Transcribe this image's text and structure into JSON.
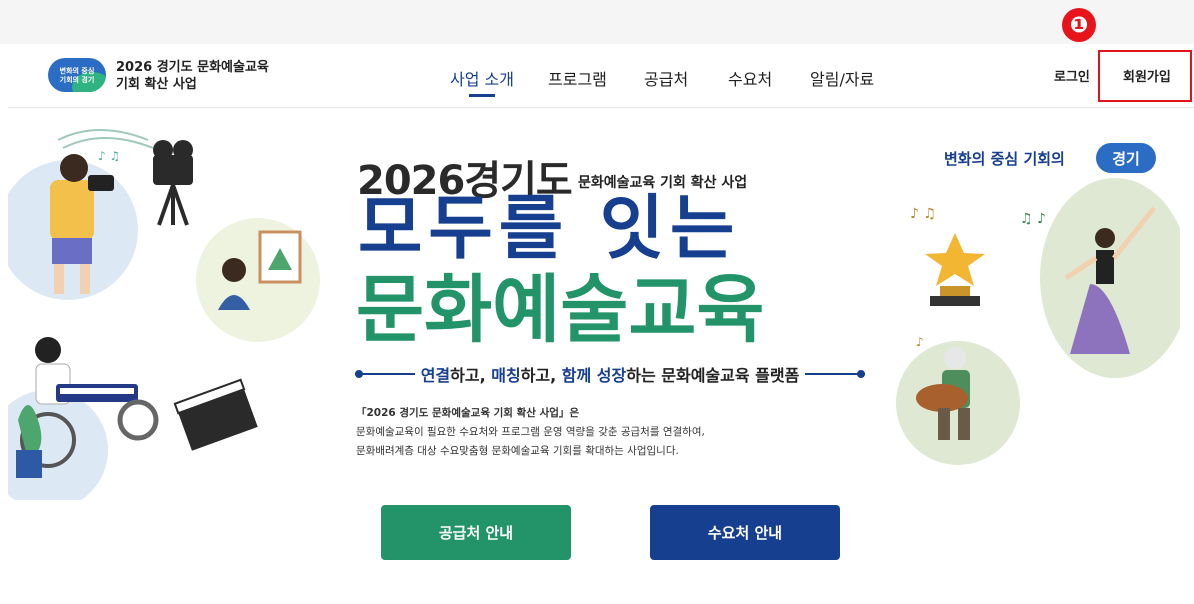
{
  "step_marker": "❶",
  "header": {
    "logo_line1": "변화의 중심",
    "logo_line2": "기회의 경기",
    "site_title_line1": "2026 경기도 문화예술교육",
    "site_title_line2": "기회 확산 사업",
    "nav": [
      {
        "label": "사업 소개",
        "active": true
      },
      {
        "label": "프로그램",
        "active": false
      },
      {
        "label": "공급처",
        "active": false
      },
      {
        "label": "수요처",
        "active": false
      },
      {
        "label": "알림/자료",
        "active": false
      }
    ],
    "login": "로그인",
    "signup": "회원가입"
  },
  "hero": {
    "slogan_text": "변화의 중심 기회의",
    "slogan_pill": "경기",
    "year_region": "2026경기도",
    "subtitle": "문화예술교육 기회 확산 사업",
    "main_line1": "모두를 잇는",
    "main_line2": "문화예술교육",
    "tagline": {
      "w1": "연결",
      "t1": "하고, ",
      "w2": "매칭",
      "t2": "하고, ",
      "w3": "함께 성장",
      "t3": "하는 문화예술교육 플랫폼"
    },
    "description": [
      "「2026 경기도 문화예술교육 기회 확산 사업」은",
      "문화예술교육이 필요한 수요처와 프로그램 운영 역량을 갖춘 공급처를 연결하여,",
      "문화배려계층 대상 수요맞춤형 문화예술교육 기회를 확대하는 사업입니다."
    ],
    "button_supplier": "공급처 안내",
    "button_demand": "수요처 안내"
  },
  "colors": {
    "navy": "#173f8f",
    "green": "#23936a",
    "highlight_red": "#e2141b"
  }
}
